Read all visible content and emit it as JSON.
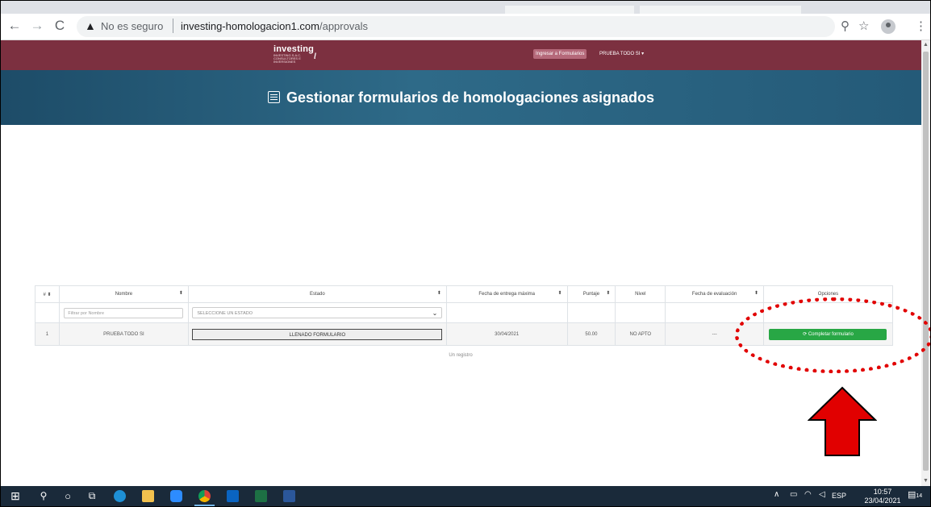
{
  "browser": {
    "security_warning": "No es seguro",
    "url_host": "investing-homologacion1.com",
    "url_path": "/approvals"
  },
  "navbar": {
    "logo_name": "investing",
    "logo_tagline": "INVESTING S.A.C. CONSULTORES E INVERSIONES",
    "ingresar_label": "Ingresar a Formularios",
    "user_label": "PRUEBA TODO SI ▾"
  },
  "hero": {
    "title": "Gestionar formularios de homologaciones asignados"
  },
  "table": {
    "columns": [
      "#",
      "Nombre",
      "Estado",
      "Fecha de entrega máxima",
      "Puntaje",
      "Nivel",
      "Fecha de evaluación",
      "Opciones"
    ],
    "filters": {
      "nombre_placeholder": "Filtrar por Nombre",
      "estado_placeholder": "SELECCIONE UN ESTADO"
    },
    "rows": [
      {
        "num": "1",
        "nombre": "PRUEBA TODO SI",
        "estado": "LLENADO FORMULARIO",
        "fecha_entrega": "30/04/2021",
        "puntaje": "50.00",
        "nivel": "NO APTO",
        "fecha_evaluacion": "---",
        "accion": "⟳ Completar formulario"
      }
    ],
    "footer": "Un registro"
  },
  "taskbar": {
    "language": "ESP",
    "time": "10:57",
    "date": "23/04/2021",
    "notifications": "14"
  },
  "colors": {
    "navbar": "#7c3040",
    "hero": "#2e6a88",
    "action_button": "#28a745",
    "annotation": "#e10000"
  }
}
